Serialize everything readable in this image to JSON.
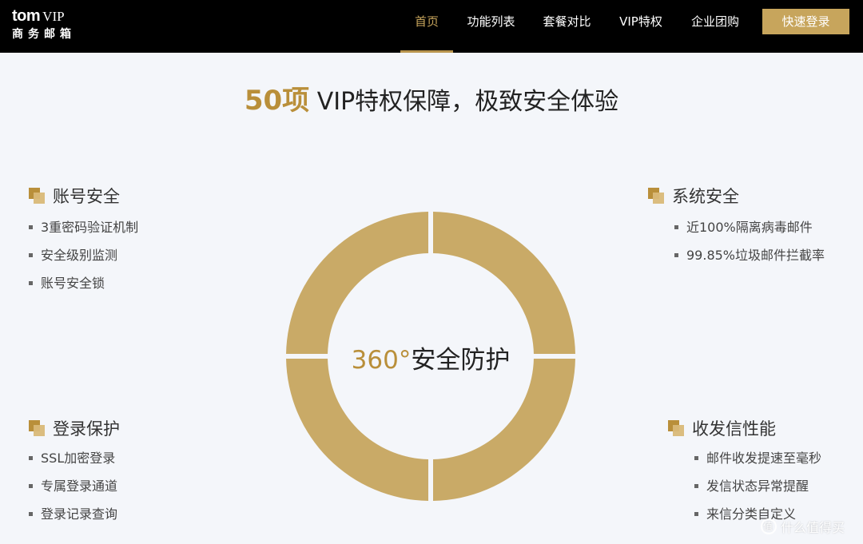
{
  "header": {
    "logo": {
      "brand": "tom",
      "vip": "VIP",
      "subtitle": "商务邮箱"
    },
    "nav": [
      {
        "label": "首页",
        "active": true
      },
      {
        "label": "功能列表",
        "active": false
      },
      {
        "label": "套餐对比",
        "active": false
      },
      {
        "label": "VIP特权",
        "active": false
      },
      {
        "label": "企业团购",
        "active": false
      }
    ],
    "login_button": "快速登录"
  },
  "headline": {
    "number": "50项",
    "text": " VIP特权保障，极致安全体验"
  },
  "ring": {
    "degree": "360°",
    "text": "安全防护",
    "color": "#c9aa67"
  },
  "blocks": {
    "account": {
      "title": "账号安全",
      "items": [
        "3重密码验证机制",
        "安全级别监测",
        "账号安全锁"
      ]
    },
    "system": {
      "title": "系统安全",
      "items": [
        "近100%隔离病毒邮件",
        "99.85%垃圾邮件拦截率"
      ]
    },
    "login": {
      "title": "登录保护",
      "items": [
        "SSL加密登录",
        "专属登录通道",
        "登录记录查询"
      ]
    },
    "mail": {
      "title": "收发信性能",
      "items": [
        "邮件收发提速至毫秒",
        "发信状态异常提醒",
        "来信分类自定义"
      ]
    }
  },
  "watermark": "什么值得买",
  "colors": {
    "accent": "#c7a55c",
    "header_bg": "#000000",
    "page_bg": "#f4f6fa"
  }
}
